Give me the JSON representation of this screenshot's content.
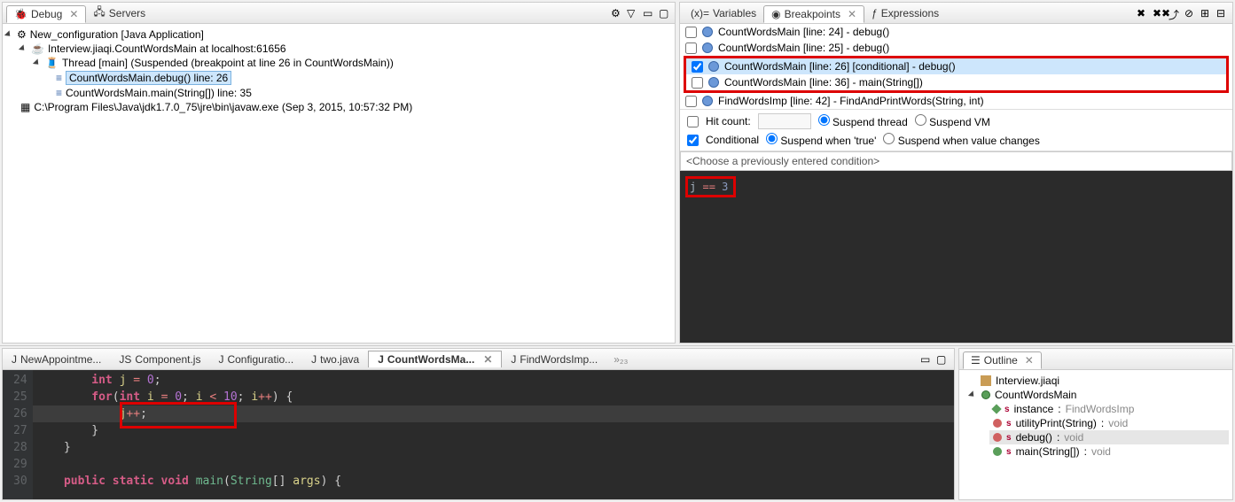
{
  "left_panel": {
    "tabs": [
      {
        "label": "Debug",
        "active": true,
        "close": true
      },
      {
        "label": "Servers",
        "active": false
      }
    ],
    "tree": {
      "config": "New_configuration [Java Application]",
      "process": "Interview.jiaqi.CountWordsMain at localhost:61656",
      "thread": "Thread [main] (Suspended (breakpoint at line 26 in CountWordsMain))",
      "frame1": "CountWordsMain.debug() line: 26",
      "frame2": "CountWordsMain.main(String[]) line: 35",
      "runtime": "C:\\Program Files\\Java\\jdk1.7.0_75\\jre\\bin\\javaw.exe (Sep 3, 2015, 10:57:32 PM)"
    }
  },
  "right_panel": {
    "tabs": [
      {
        "label": "Variables"
      },
      {
        "label": "Breakpoints",
        "active": true
      },
      {
        "label": "Expressions"
      }
    ],
    "breakpoints": [
      {
        "checked": false,
        "label": "CountWordsMain [line: 24] - debug()"
      },
      {
        "checked": false,
        "label": "CountWordsMain [line: 25] - debug()"
      },
      {
        "checked": true,
        "label": "CountWordsMain [line: 26] [conditional] - debug()",
        "selected": true,
        "highlighted": true
      },
      {
        "checked": false,
        "label": "CountWordsMain [line: 36] - main(String[])"
      },
      {
        "checked": false,
        "label": "FindWordsImp [line: 42] - FindAndPrintWords(String, int)"
      }
    ],
    "hit_count_label": "Hit count:",
    "suspend_thread": "Suspend thread",
    "suspend_vm": "Suspend VM",
    "conditional_label": "Conditional",
    "suspend_true": "Suspend when 'true'",
    "suspend_change": "Suspend when value changes",
    "prev_condition": "<Choose a previously entered condition>",
    "condition_code": {
      "var": "j",
      "op": "==",
      "val": "3"
    }
  },
  "editor": {
    "tabs": [
      {
        "label": "NewAppointme...",
        "icon": "java"
      },
      {
        "label": "Component.js",
        "icon": "js"
      },
      {
        "label": "Configuratio...",
        "icon": "java"
      },
      {
        "label": "two.java",
        "icon": "java"
      },
      {
        "label": "CountWordsMa...",
        "icon": "java",
        "active": true,
        "close": true
      },
      {
        "label": "FindWordsImp...",
        "icon": "java"
      }
    ],
    "more": "»₂₃",
    "lines": [
      "24",
      "25",
      "26",
      "27",
      "28",
      "29",
      "30"
    ]
  },
  "chart_data": {
    "type": "table",
    "title": "CountWordsMain.java source snippet",
    "line_numbers": [
      24,
      25,
      26,
      27,
      28,
      29,
      30
    ],
    "code_lines": [
      "        int j = 0;",
      "        for(int i = 0; i < 10; i++) {",
      "            j++;",
      "        }",
      "    }",
      "",
      "    public static void main(String[] args) {"
    ],
    "current_line": 26,
    "highlighted_range": {
      "line": 26,
      "text": "j++;"
    }
  },
  "outline": {
    "tab": "Outline",
    "package": "Interview.jiaqi",
    "class": "CountWordsMain",
    "members": [
      {
        "name": "instance",
        "ret": "FindWordsImp",
        "kind": "field-static"
      },
      {
        "name": "utilityPrint(String)",
        "ret": "void",
        "kind": "method-static"
      },
      {
        "name": "debug()",
        "ret": "void",
        "kind": "method-static",
        "selected": true
      },
      {
        "name": "main(String[])",
        "ret": "void",
        "kind": "method-static"
      }
    ]
  }
}
